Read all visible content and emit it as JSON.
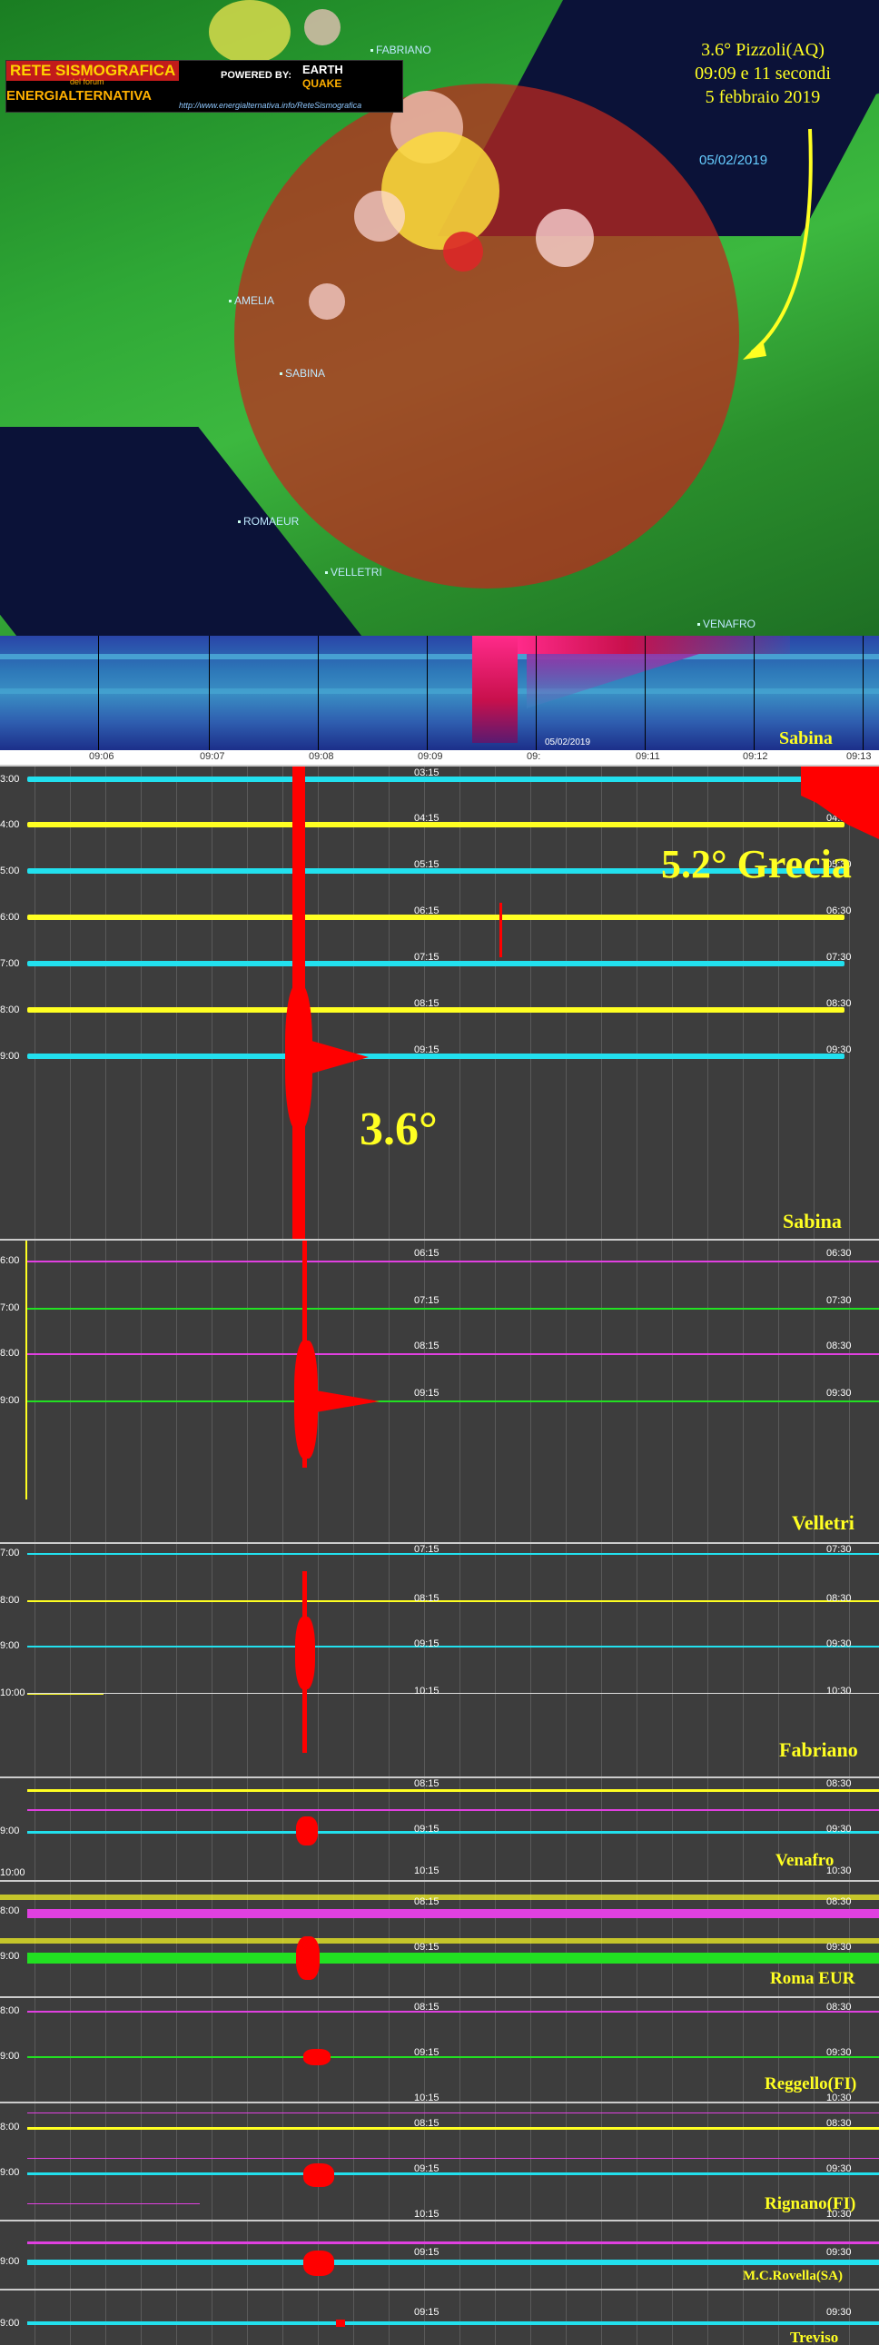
{
  "map": {
    "logo_title": "RETE SISMOGRAFICA",
    "logo_sub": "del forum",
    "logo_brand": "ENERGIALTERNATIVA",
    "logo_powered": "POWERED BY:",
    "logo_earth": "EARTH",
    "logo_quake": "QUAKE",
    "logo_url": "http://www.energialternativa.info/ReteSismografica",
    "towns": [
      "FABRIANO",
      "AMELIA",
      "SABINA",
      "ROMAEUR",
      "VELLETRI",
      "VENAFRO"
    ],
    "event_line1": "3.6° Pizzoli(AQ)",
    "event_line2": "09:09 e 11 secondi",
    "event_line3": "5 febbraio 2019",
    "date_small": "05/02/2019",
    "colors": {
      "circle": "#c0392b",
      "arrow": "#ffff22"
    }
  },
  "spectrogram": {
    "station": "Sabina",
    "date_stamp": "05/02/2019",
    "ticks": [
      "09:06",
      "09:07",
      "09:08",
      "09:09",
      "09:",
      "09:11",
      "09:12",
      "09:13"
    ]
  },
  "panels": {
    "sabina": {
      "name": "Sabina",
      "rows": [
        "3:00",
        "4:00",
        "5:00",
        "6:00",
        "7:00",
        "8:00",
        "9:00"
      ],
      "mid_times": [
        "03:15",
        "04:15",
        "05:15",
        "06:15",
        "07:15",
        "08:15",
        "09:15"
      ],
      "right_times": [
        "04:30",
        "05:30",
        "06:30",
        "07:30",
        "08:30",
        "09:30"
      ],
      "mag_label": "3.6°",
      "greece_label": "5.2° Grecia"
    },
    "velletri": {
      "name": "Velletri",
      "rows": [
        "6:00",
        "7:00",
        "8:00",
        "9:00"
      ],
      "mid_times": [
        "06:15",
        "07:15",
        "08:15",
        "09:15"
      ],
      "right_times": [
        "06:30",
        "07:30",
        "08:30",
        "09:30"
      ]
    },
    "fabriano": {
      "name": "Fabriano",
      "rows": [
        "7:00",
        "8:00",
        "9:00",
        "10:00"
      ],
      "mid_times": [
        "07:15",
        "08:15",
        "09:15",
        "10:15"
      ],
      "right_times": [
        "07:30",
        "08:30",
        "09:30",
        "10:30"
      ]
    },
    "venafro": {
      "name": "Venafro",
      "rows": [
        "",
        "9:00",
        "10:00"
      ],
      "mid_times": [
        "08:15",
        "09:15",
        "10:15"
      ],
      "right_times": [
        "08:30",
        "09:30",
        "10:30"
      ]
    },
    "romaeur": {
      "name": "Roma EUR",
      "rows": [
        "8:00",
        "9:00"
      ],
      "mid_times": [
        "08:15",
        "09:15"
      ],
      "right_times": [
        "08:30",
        "09:30"
      ]
    },
    "reggello": {
      "name": "Reggello(FI)",
      "rows": [
        "8:00",
        "9:00"
      ],
      "mid_times": [
        "08:15",
        "09:15",
        "10:15"
      ],
      "right_times": [
        "08:30",
        "09:30",
        "10:30"
      ]
    },
    "rignano": {
      "name": "Rignano(FI)",
      "rows": [
        "8:00",
        "9:00"
      ],
      "mid_times": [
        "08:15",
        "09:15",
        "10:15"
      ],
      "right_times": [
        "08:30",
        "09:30",
        "10:30"
      ]
    },
    "mcrovella": {
      "name": "M.C.Rovella(SA)",
      "rows": [
        "9:00"
      ],
      "mid_times": [
        "09:15"
      ],
      "right_times": [
        "09:30"
      ]
    },
    "treviso": {
      "name": "Treviso",
      "rows": [
        "9:00"
      ],
      "mid_times": [
        "09:15"
      ],
      "right_times": [
        "09:30"
      ]
    }
  }
}
